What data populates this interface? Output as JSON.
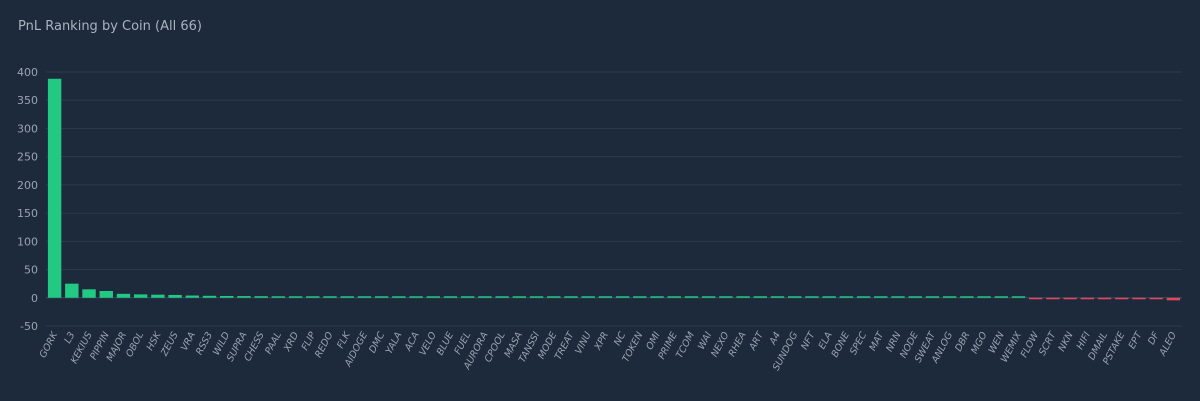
{
  "chart_data": {
    "type": "bar",
    "title": "PnL Ranking by Coin (All 66)",
    "xlabel": "",
    "ylabel": "",
    "ylim": [
      -50,
      400
    ],
    "yticks": [
      -50,
      0,
      50,
      100,
      150,
      200,
      250,
      300,
      350,
      400
    ],
    "grid": true,
    "colors": {
      "positive": "#22c983",
      "negative": "#e0485c"
    },
    "categories": [
      "GORK",
      "L3",
      "KEKIUS",
      "PIPPIN",
      "MAJOR",
      "OBOL",
      "HSK",
      "ZEUS",
      "VRA",
      "RSS3",
      "WILD",
      "SUPRA",
      "CHESS",
      "PAAL",
      "XRD",
      "FLIP",
      "REDO",
      "FLK",
      "AIDOGE",
      "DMC",
      "YALA",
      "ACA",
      "VELO",
      "BLUE",
      "FUEL",
      "AURORA",
      "CPOOL",
      "MASA",
      "TANSSI",
      "MODE",
      "TREAT",
      "VINU",
      "XPR",
      "NC",
      "TOKEN",
      "OMI",
      "PRIME",
      "TCOM",
      "WAI",
      "NEXO",
      "RHEA",
      "ART",
      "A4",
      "SUNDOG",
      "NFT",
      "ELA",
      "BONE",
      "SPEC",
      "MAT",
      "NRN",
      "NODE",
      "SWEAT",
      "ANLOG",
      "DBR",
      "MGO",
      "WEN",
      "WEMIX",
      "FLOW",
      "SCRT",
      "NKN",
      "HIFI",
      "DMAIL",
      "PSTAKE",
      "EPT",
      "DF",
      "ALEO"
    ],
    "values": [
      388,
      25,
      15,
      12,
      7,
      6,
      5.5,
      5,
      4,
      3.5,
      3.2,
      3,
      2.8,
      2.6,
      2.4,
      2.2,
      2,
      1.8,
      1.6,
      1.4,
      0.9,
      0.8,
      0.75,
      0.7,
      0.65,
      0.6,
      0.55,
      0.5,
      0.48,
      0.45,
      0.42,
      0.4,
      0.38,
      0.36,
      0.34,
      0.32,
      0.3,
      0.28,
      0.26,
      0.24,
      0.22,
      0.2,
      0.19,
      0.18,
      0.17,
      0.16,
      0.15,
      0.14,
      0.13,
      0.12,
      0.11,
      0.1,
      0.9,
      1.0,
      1.1,
      1.2,
      1.3,
      -1.5,
      -1.7,
      -1.8,
      -1.9,
      -2.0,
      -2.1,
      -2.3,
      -2.6,
      -4.5
    ]
  }
}
